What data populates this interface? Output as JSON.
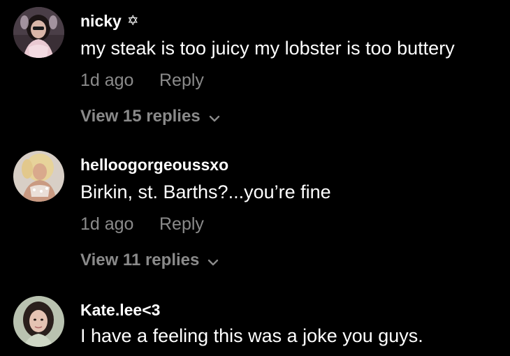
{
  "comments": [
    {
      "username": "nicky",
      "badge_icon": "star-of-david-icon",
      "badge_glyph": "✡",
      "text": "my steak is too juicy my lobster is too buttery",
      "time": "1d ago",
      "reply_label": "Reply",
      "view_replies": "View 15 replies"
    },
    {
      "username": "helloogorgeoussxo",
      "text": "Birkin, st. Barths?...you’re fine",
      "time": "1d ago",
      "reply_label": "Reply",
      "view_replies": "View 11 replies"
    },
    {
      "username": "Kate.lee<3",
      "text": "I have a feeling this was a joke you guys."
    }
  ],
  "colors": {
    "background": "#000000",
    "primary_text": "#ffffff",
    "secondary_text": "#8a8a8a"
  }
}
